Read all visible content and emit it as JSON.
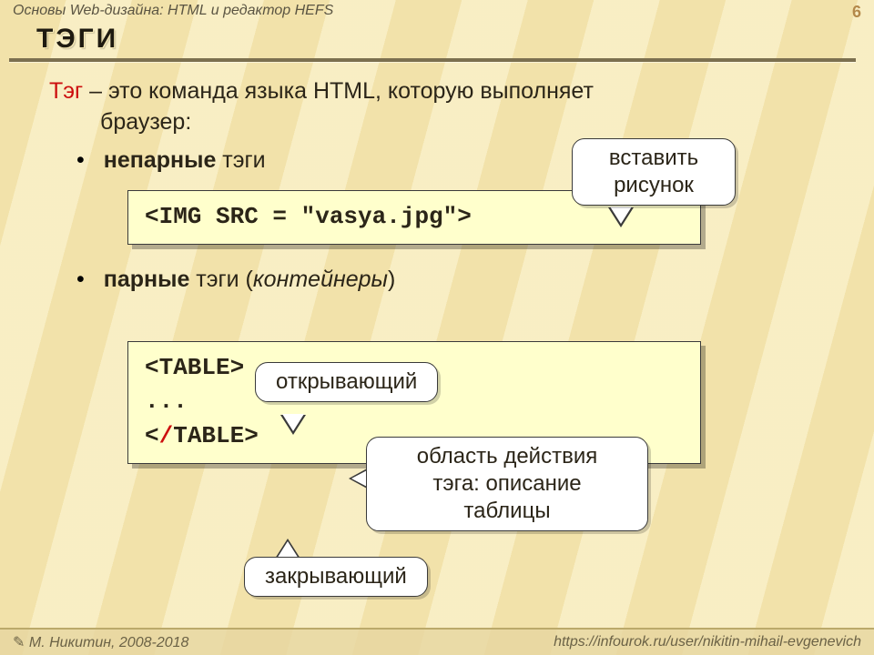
{
  "header": {
    "breadcrumb": "Основы Web-дизайна: HTML и редактор HEFS",
    "page_number": "6"
  },
  "title": "ТЭГИ",
  "intro": {
    "term": "Тэг",
    "dash": " – ",
    "rest_line1": "это команда языка HTML, которую выполняет",
    "rest_line2": "браузер:"
  },
  "bullets": {
    "unpaired_bold": "непарные",
    "unpaired_rest": " тэги",
    "paired_bold": "парные",
    "paired_rest": " тэги (",
    "paired_ital": "контейнеры",
    "paired_close": ")"
  },
  "code": {
    "img_tag": "<IMG SRC = \"vasya.jpg\">",
    "table_open": "<TABLE>",
    "table_mid": "...",
    "table_close_lt": "<",
    "table_close_slash": "/",
    "table_close_rest": "TABLE>"
  },
  "callouts": {
    "insert_l1": "вставить",
    "insert_l2": "рисунок",
    "opening": "открывающий",
    "scope_l1": "область действия",
    "scope_l2": "тэга: описание",
    "scope_l3": "таблицы",
    "closing": "закрывающий"
  },
  "footer": {
    "author": "М. Никитин, 2008-2018",
    "url": "https://infourok.ru/user/nikitin-mihail-evgenevich"
  }
}
